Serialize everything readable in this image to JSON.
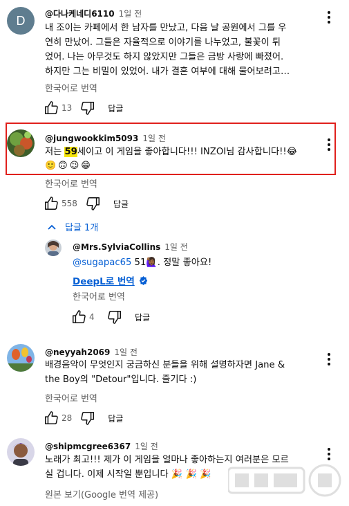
{
  "comments": [
    {
      "author": "@다나케네디6110",
      "time": "1일 전",
      "avatar_letter": "D",
      "avatar_color": "#5f7d8f",
      "lines": [
        "내 조이는 카페에서 한 남자를 만났고, 다음 날 공원에서 그를 우",
        "연히 만났어. 그들은 자율적으로 이야기를 나누었고, 불꽃이 튀",
        "었어. 나는 아무것도 하지 않았지만 그들은 금방 사랑에 빠졌어.",
        "하지만 그는 비밀이 있었어. 내가 결혼 여부에 대해 물어보려고…"
      ],
      "translate": "한국어로 번역",
      "likes": "13",
      "reply": "답글"
    },
    {
      "author": "@jungwookkim5093",
      "time": "1일 전",
      "text_before": "저는 ",
      "text_highlight": "59",
      "text_after": "세이고 이 게임을 좋아합니다!!! INZOI님 감사합니다!!😂",
      "emojis": "🙂🙃😉😁",
      "translate": "한국어로 번역",
      "likes": "558",
      "reply": "답글",
      "replies_toggle": "답글 1개"
    },
    {
      "author": "@neyyah2069",
      "time": "1일 전",
      "lines": [
        "배경음악이 무엇인지 궁금하신 분들을 위해 설명하자면 Jane &",
        "the Boy의 \"Detour\"입니다. 즐기다 :)"
      ],
      "translate": "한국어로 번역",
      "likes": "28",
      "reply": "답글"
    },
    {
      "author": "@shipmcgree6367",
      "time": "1일 전",
      "lines": [
        "노래가 최고!!! 제가 이 게임을 얼마나 좋아하는지 여러분은 모르",
        "실 겁니다. 이제 시작일 뿐입니다 🎉 🎉 🎉"
      ],
      "translate": "원본 보기(Google 번역 제공)"
    }
  ],
  "reply_comment": {
    "author": "@Mrs.SylviaCollins",
    "time": "1일 전",
    "mention": "@sugapac65",
    "text": " 51🙋🏾‍♀️. 정말 좋아요!",
    "deepl": "DeepL로 번역",
    "translate": "한국어로 번역",
    "likes": "4",
    "reply": "답글"
  },
  "colors": {
    "highlight_border": "#e0201c",
    "link_blue": "#065fd4",
    "highlight_fill": "#f5e50a"
  }
}
